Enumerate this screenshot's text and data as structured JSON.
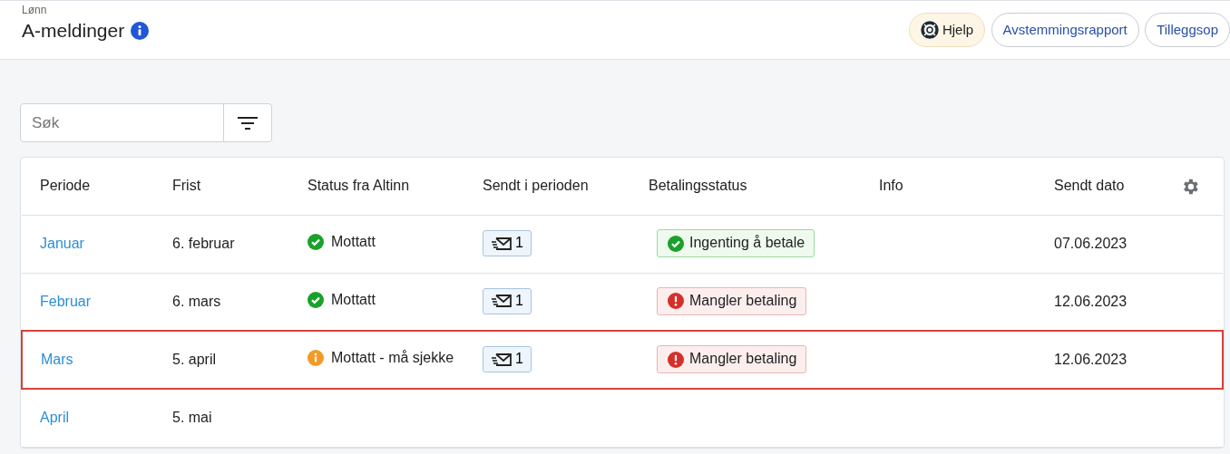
{
  "header": {
    "breadcrumb": "Lønn",
    "title": "A-meldinger",
    "buttons": [
      {
        "label": "Hjelp",
        "kind": "help"
      },
      {
        "label": "Avstemmingsrapport",
        "kind": "plain"
      },
      {
        "label": "Tilleggsop",
        "kind": "plain"
      }
    ]
  },
  "search": {
    "placeholder": "Søk"
  },
  "table": {
    "columns": [
      "Periode",
      "Frist",
      "Status fra Altinn",
      "Sendt i perioden",
      "Betalingsstatus",
      "Info",
      "Sendt dato"
    ],
    "rows": [
      {
        "period": "Januar",
        "deadline": "6. februar",
        "status": {
          "kind": "ok",
          "label": "Mottatt"
        },
        "sent": "1",
        "payment": {
          "kind": "ok",
          "label": "Ingenting å betale"
        },
        "sent_date": "07.06.2023",
        "highlighted": false
      },
      {
        "period": "Februar",
        "deadline": "6. mars",
        "status": {
          "kind": "ok",
          "label": "Mottatt"
        },
        "sent": "1",
        "payment": {
          "kind": "missing",
          "label": "Mangler betaling"
        },
        "sent_date": "12.06.2023",
        "highlighted": false
      },
      {
        "period": "Mars",
        "deadline": "5. april",
        "status": {
          "kind": "warning",
          "label": "Mottatt - må sjekke"
        },
        "sent": "1",
        "payment": {
          "kind": "missing",
          "label": "Mangler betaling"
        },
        "sent_date": "12.06.2023",
        "highlighted": true
      },
      {
        "period": "April",
        "deadline": "5. mai",
        "highlighted": false
      }
    ]
  }
}
